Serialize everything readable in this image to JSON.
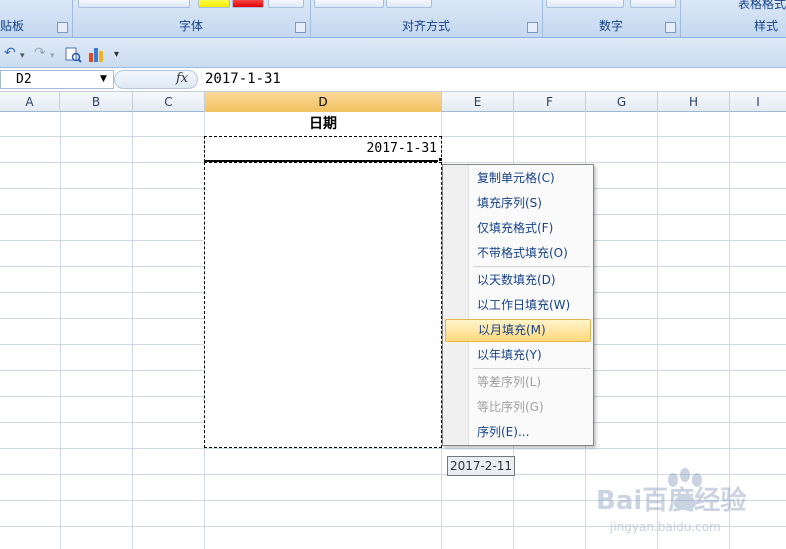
{
  "ribbon": {
    "groups": [
      {
        "label": "贴板"
      },
      {
        "label": "字体"
      },
      {
        "label": "对齐方式"
      },
      {
        "label": "数字"
      },
      {
        "label": "样式"
      }
    ],
    "styles_partial": "表格格式"
  },
  "formula_bar": {
    "name_box": "D2",
    "fx_label": "fx",
    "formula": "2017-1-31"
  },
  "columns": [
    "A",
    "B",
    "C",
    "D",
    "E",
    "F",
    "G",
    "H",
    "I"
  ],
  "selected_column": "D",
  "cells": {
    "header": "日期",
    "date_value": "2017-1-31"
  },
  "context_menu": {
    "items": [
      {
        "label": "复制单元格(C)",
        "enabled": true
      },
      {
        "label": "填充序列(S)",
        "enabled": true
      },
      {
        "label": "仅填充格式(F)",
        "enabled": true
      },
      {
        "label": "不带格式填充(O)",
        "enabled": true
      },
      {
        "label": "以天数填充(D)",
        "enabled": true
      },
      {
        "label": "以工作日填充(W)",
        "enabled": true
      },
      {
        "label": "以月填充(M)",
        "enabled": true,
        "highlighted": true
      },
      {
        "label": "以年填充(Y)",
        "enabled": true
      },
      {
        "label": "等差序列(L)",
        "enabled": false
      },
      {
        "label": "等比序列(G)",
        "enabled": false
      },
      {
        "label": "序列(E)...",
        "enabled": true
      }
    ]
  },
  "tooltip": "2017-2-11",
  "watermark": {
    "line1": "Bai百度经验",
    "line2": "jingyan.baidu.com"
  },
  "colors": {
    "menu_text": "#15428b",
    "highlight": "#ffd87c",
    "selected_header": "#f1c15f",
    "grid_line": "#d0d7e5"
  }
}
